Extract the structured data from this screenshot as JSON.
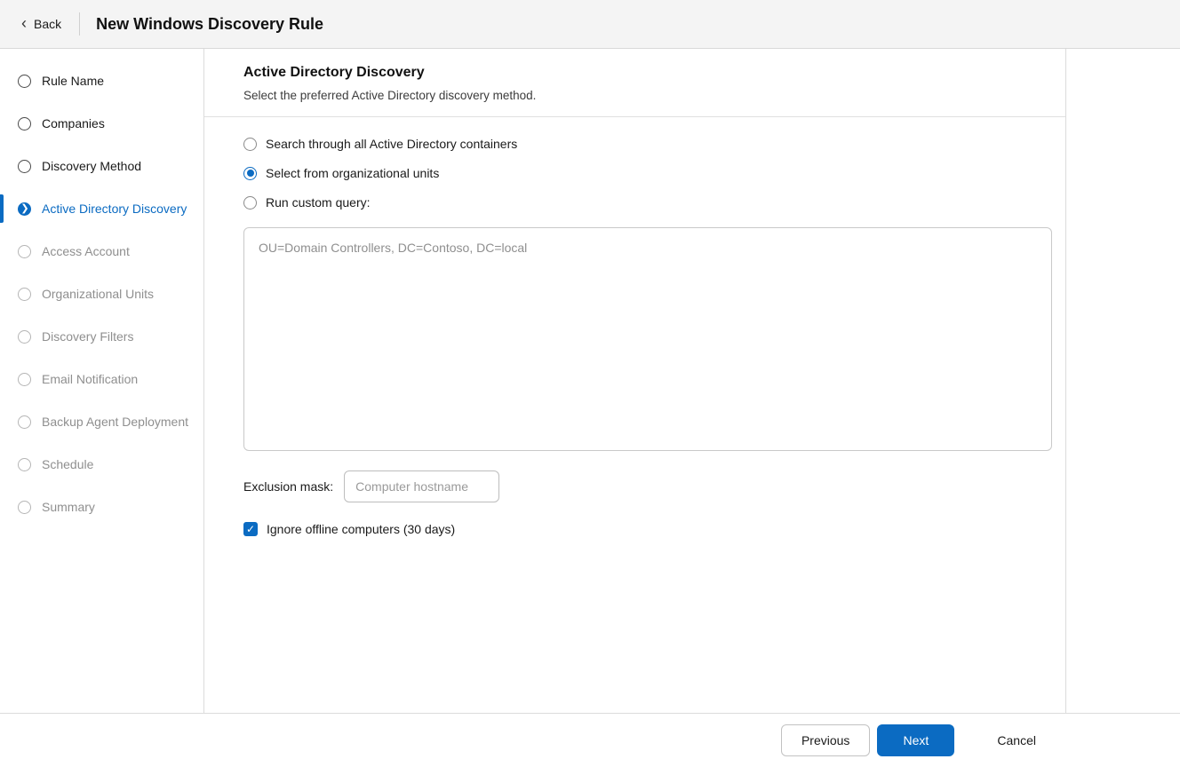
{
  "colors": {
    "accent": "#0b6bc2"
  },
  "header": {
    "back_label": "Back",
    "back_chevron": "‹",
    "title": "New Windows Discovery Rule"
  },
  "sidebar": {
    "steps": [
      {
        "label": "Rule Name",
        "state": "default"
      },
      {
        "label": "Companies",
        "state": "default"
      },
      {
        "label": "Discovery Method",
        "state": "default"
      },
      {
        "label": "Active Directory Discovery",
        "state": "active"
      },
      {
        "label": "Access Account",
        "state": "disabled"
      },
      {
        "label": "Organizational Units",
        "state": "disabled"
      },
      {
        "label": "Discovery Filters",
        "state": "disabled"
      },
      {
        "label": "Email Notification",
        "state": "disabled"
      },
      {
        "label": "Backup Agent Deployment",
        "state": "disabled"
      },
      {
        "label": "Schedule",
        "state": "disabled"
      },
      {
        "label": "Summary",
        "state": "disabled"
      }
    ],
    "active_step_chevron": "❯"
  },
  "main": {
    "title": "Active Directory Discovery",
    "subtitle": "Select the preferred Active Directory discovery method.",
    "options": [
      {
        "label": "Search through all Active Directory containers",
        "selected": false
      },
      {
        "label": "Select from organizational units",
        "selected": true
      },
      {
        "label": "Run custom query:",
        "selected": false
      }
    ],
    "query": {
      "value": "",
      "placeholder": "OU=Domain Controllers, DC=Contoso, DC=local"
    },
    "exclusion_mask": {
      "label": "Exclusion mask:",
      "value": "",
      "placeholder": "Computer hostname"
    },
    "ignore_offline": {
      "label": "Ignore offline computers (30 days)",
      "checked": true,
      "check_glyph": "✓"
    }
  },
  "footer": {
    "previous_label": "Previous",
    "next_label": "Next",
    "cancel_label": "Cancel"
  }
}
